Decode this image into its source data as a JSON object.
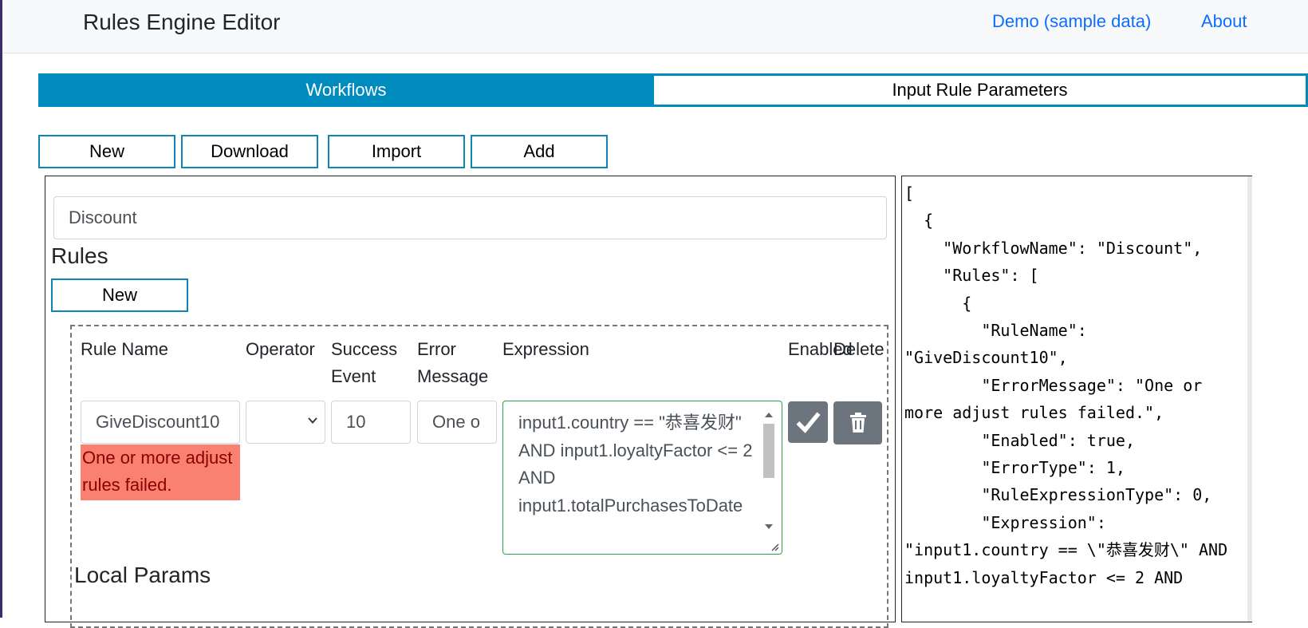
{
  "header": {
    "title": "Rules Engine Editor",
    "nav": {
      "demo_label": "Demo (sample data)",
      "about_label": "About"
    }
  },
  "tabs": [
    {
      "label": "Workflows",
      "active": true
    },
    {
      "label": "Input Rule Parameters",
      "active": false
    }
  ],
  "toolbar": {
    "new_label": "New",
    "download_label": "Download",
    "import_label": "Import",
    "add_label": "Add"
  },
  "workflow": {
    "name_value": "Discount",
    "rules_heading": "Rules",
    "new_rule_label": "New",
    "columns": {
      "rule_name": "Rule Name",
      "operator": "Operator",
      "success_event": "Success Event",
      "error_message": "Error Message",
      "expression": "Expression",
      "enabled": "Enabled",
      "delete": "Delete"
    },
    "rule": {
      "name_value": "GiveDiscount10",
      "operator_value": "",
      "success_event_value": "10",
      "error_message_value": "One or more adjust rules failed.",
      "error_message_visible": "One o",
      "validation_error": "One or more adjust rules failed.",
      "expression_value": "input1.country == \"恭喜发财\" AND input1.loyaltyFactor <= 2 AND input1.totalPurchasesToDate",
      "enabled": true
    },
    "local_params_heading": "Local Params"
  },
  "json_preview": "[\n  {\n    \"WorkflowName\": \"Discount\",\n    \"Rules\": [\n      {\n        \"RuleName\": \"GiveDiscount10\",\n        \"ErrorMessage\": \"One or more adjust rules failed.\",\n        \"Enabled\": true,\n        \"ErrorType\": 1,\n        \"RuleExpressionType\": 0,\n        \"Expression\": \"input1.country == \\\"恭喜发财\\\" AND input1.loyaltyFactor <= 2 AND",
  "colors": {
    "accent": "#008bbf",
    "button_border": "#0e86b3",
    "error_bg": "#fa8072",
    "error_text": "#8b0000",
    "link": "#0d6efd",
    "valid_border": "#28a745",
    "enabled_button": "#6c757d",
    "delete_button": "#6c757d"
  },
  "icons": {
    "enabled": "check-icon",
    "delete": "trash-icon",
    "select": "chevron-down-icon"
  }
}
